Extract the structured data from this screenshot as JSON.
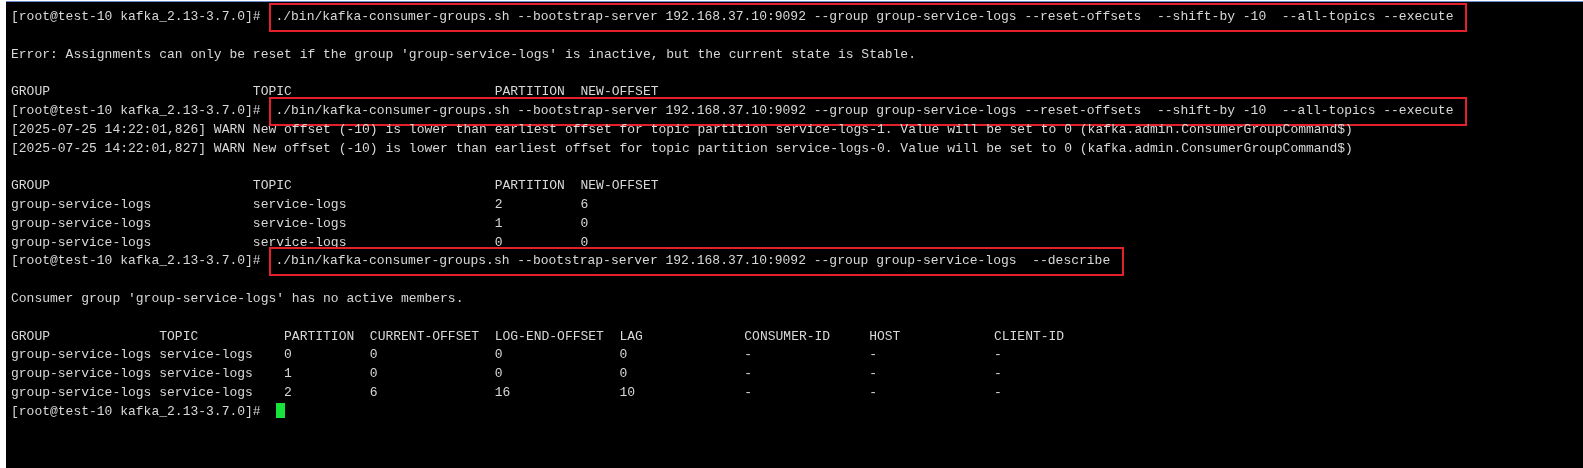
{
  "terminal": {
    "lines": [
      {
        "kind": "boxed-command",
        "prompt": "[root@test-10 kafka_2.13-3.7.0]#",
        "command": "./bin/kafka-consumer-groups.sh --bootstrap-server 192.168.37.10:9092 --group group-service-logs --reset-offsets  --shift-by -10  --all-topics --execute"
      },
      {
        "kind": "blank"
      },
      {
        "kind": "output",
        "text": "Error: Assignments can only be reset if the group 'group-service-logs' is inactive, but the current state is Stable."
      },
      {
        "kind": "blank"
      },
      {
        "kind": "output",
        "text": "GROUP                          TOPIC                          PARTITION  NEW-OFFSET"
      },
      {
        "kind": "boxed-command",
        "prompt": "[root@test-10 kafka_2.13-3.7.0]#",
        "command": "./bin/kafka-consumer-groups.sh --bootstrap-server 192.168.37.10:9092 --group group-service-logs --reset-offsets  --shift-by -10  --all-topics --execute"
      },
      {
        "kind": "output",
        "text": "[2025-07-25 14:22:01,826] WARN New offset (-10) is lower than earliest offset for topic partition service-logs-1. Value will be set to 0 (kafka.admin.ConsumerGroupCommand$)"
      },
      {
        "kind": "output",
        "text": "[2025-07-25 14:22:01,827] WARN New offset (-10) is lower than earliest offset for topic partition service-logs-0. Value will be set to 0 (kafka.admin.ConsumerGroupCommand$)"
      },
      {
        "kind": "blank"
      },
      {
        "kind": "output",
        "text": "GROUP                          TOPIC                          PARTITION  NEW-OFFSET"
      },
      {
        "kind": "output",
        "text": "group-service-logs             service-logs                   2          6"
      },
      {
        "kind": "output",
        "text": "group-service-logs             service-logs                   1          0"
      },
      {
        "kind": "output",
        "text": "group-service-logs             service-logs                   0          0"
      },
      {
        "kind": "boxed-command",
        "prompt": "[root@test-10 kafka_2.13-3.7.0]#",
        "command": "./bin/kafka-consumer-groups.sh --bootstrap-server 192.168.37.10:9092 --group group-service-logs  --describe"
      },
      {
        "kind": "blank"
      },
      {
        "kind": "output",
        "text": "Consumer group 'group-service-logs' has no active members."
      },
      {
        "kind": "blank"
      },
      {
        "kind": "output",
        "text": "GROUP              TOPIC           PARTITION  CURRENT-OFFSET  LOG-END-OFFSET  LAG             CONSUMER-ID     HOST            CLIENT-ID"
      },
      {
        "kind": "output",
        "text": "group-service-logs service-logs    0          0               0               0               -               -               -"
      },
      {
        "kind": "output",
        "text": "group-service-logs service-logs    1          0               0               0               -               -               -"
      },
      {
        "kind": "output",
        "text": "group-service-logs service-logs    2          6               16              10              -               -               -"
      },
      {
        "kind": "cursor-prompt",
        "prompt": "[root@test-10 kafka_2.13-3.7.0]#"
      }
    ]
  }
}
